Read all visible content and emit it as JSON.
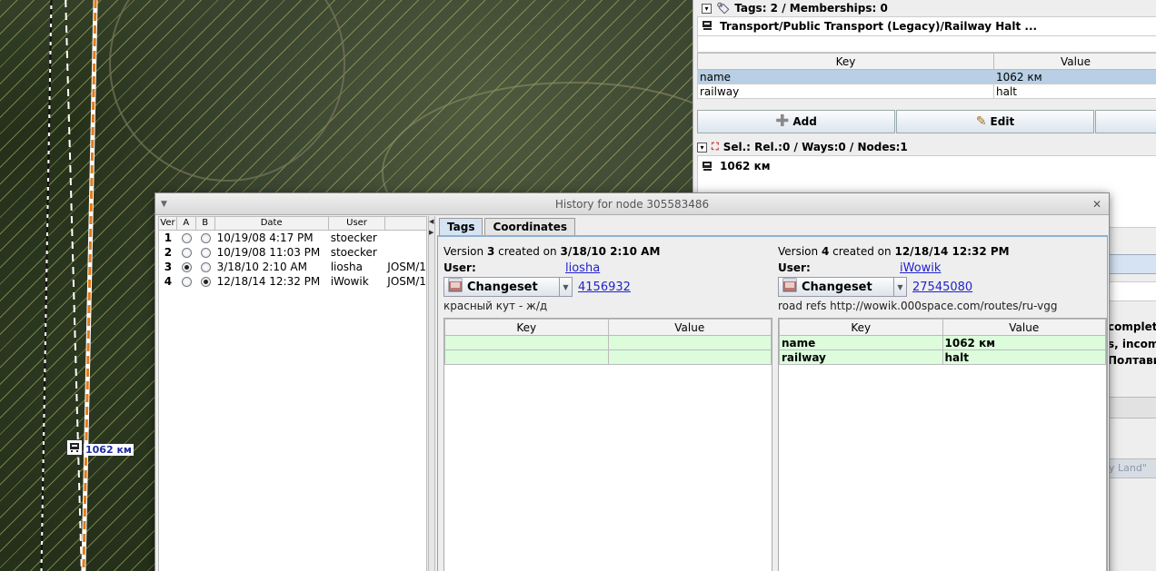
{
  "map": {
    "node_label": "1062 км"
  },
  "right_panel": {
    "tags_header": "Tags: 2 / Memberships: 0",
    "preset": "Transport/Public Transport (Legacy)/Railway Halt ...",
    "columns": [
      "Key",
      "Value"
    ],
    "tags": [
      {
        "key": "name",
        "value": "1062 км",
        "selected": true
      },
      {
        "key": "railway",
        "value": "halt",
        "selected": false
      }
    ],
    "buttons": {
      "add": "Add",
      "edit": "Edit"
    },
    "selection_header": "Sel.: Rel.:0 / Ways:0 / Nodes:1",
    "selection_item": "1062 км",
    "behind_text": [
      {
        "text": "complet"
      },
      {
        "text": "s, incom"
      },
      {
        "text": "Полтави"
      },
      {
        "text": "y Land\""
      }
    ]
  },
  "dialog": {
    "title": "History for node 305583486",
    "version_columns": [
      "Ver",
      "A",
      "B",
      "Date",
      "User"
    ],
    "versions": [
      {
        "ver": "1",
        "a": false,
        "b": false,
        "date": "10/19/08 4:17 PM",
        "user": "stoecker",
        "editor": ""
      },
      {
        "ver": "2",
        "a": false,
        "b": false,
        "date": "10/19/08 11:03 PM",
        "user": "stoecker",
        "editor": ""
      },
      {
        "ver": "3",
        "a": true,
        "b": false,
        "date": "3/18/10 2:10 AM",
        "user": "liosha",
        "editor": "JOSM/1"
      },
      {
        "ver": "4",
        "a": false,
        "b": true,
        "date": "12/18/14 12:32 PM",
        "user": "iWowik",
        "editor": "JOSM/1"
      }
    ],
    "tabs": [
      "Tags",
      "Coordinates"
    ],
    "left": {
      "version_prefix": "Version",
      "version": "3",
      "created_on": "created on",
      "date": "3/18/10 2:10 AM",
      "user_label": "User:",
      "user": "liosha",
      "changeset_label": "Changeset",
      "changeset": "4156932",
      "comment": "красный кут - ж/д",
      "columns": [
        "Key",
        "Value"
      ],
      "rows": [
        {
          "key": "",
          "value": ""
        },
        {
          "key": "",
          "value": ""
        }
      ]
    },
    "right": {
      "version_prefix": "Version",
      "version": "4",
      "created_on": "created on",
      "date": "12/18/14 12:32 PM",
      "user_label": "User:",
      "user": "iWowik",
      "changeset_label": "Changeset",
      "changeset": "27545080",
      "comment": "road refs http://wowik.000space.com/routes/ru-vgg",
      "columns": [
        "Key",
        "Value"
      ],
      "rows": [
        {
          "key": "name",
          "value": "1062 км"
        },
        {
          "key": "railway",
          "value": "halt"
        }
      ]
    }
  }
}
